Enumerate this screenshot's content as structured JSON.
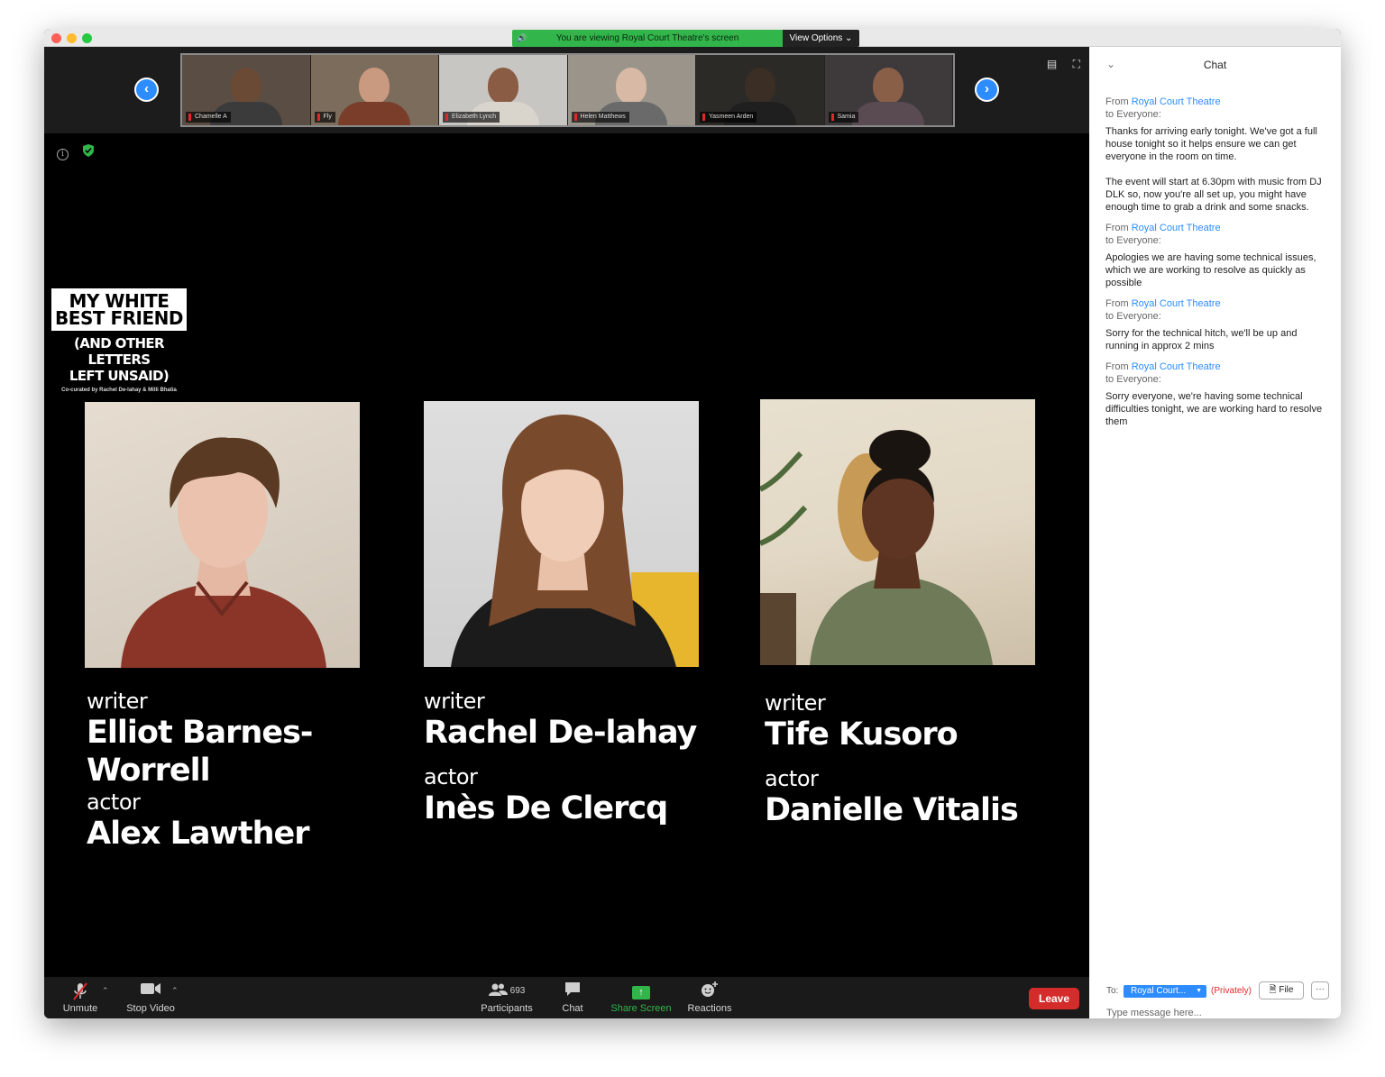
{
  "window": {
    "share_banner": "You are viewing Royal Court Theatre's screen",
    "view_options": "View Options ⌄"
  },
  "thumbnails": [
    {
      "name": "Chamelle A",
      "skin": "#6b4a35",
      "shirt": "#3b3b3b",
      "bg": "#5a4e44"
    },
    {
      "name": "Fly",
      "skin": "#c99a80",
      "shirt": "#7a3d2a",
      "bg": "#7b6c5c"
    },
    {
      "name": "Elizabeth Lynch",
      "skin": "#8a5c44",
      "shirt": "#d9d4cc",
      "bg": "#c8c6c2"
    },
    {
      "name": "Helen Matthews",
      "skin": "#d8b9a5",
      "shirt": "#6a6a6a",
      "bg": "#9a948a"
    },
    {
      "name": "Yasmeen Arden",
      "skin": "#3a2e25",
      "shirt": "#1f1f1f",
      "bg": "#2c2a26"
    },
    {
      "name": "Samia",
      "skin": "#8a5f48",
      "shirt": "#5a4a52",
      "bg": "#3e3a3c"
    }
  ],
  "poster": {
    "title_line1": "MY WHITE",
    "title_line2": "BEST FRIEND",
    "subtitle_line1": "(AND OTHER LETTERS",
    "subtitle_line2": "LEFT UNSAID)",
    "credit": "Co-curated by Rachel De-lahay & Milli Bhatia"
  },
  "credits": [
    {
      "role1": "writer",
      "name1": "Elliot Barnes-Worrell",
      "role2": "actor",
      "name2": "Alex Lawther"
    },
    {
      "role1": "writer",
      "name1": "Rachel De-lahay",
      "role2": "actor",
      "name2": "Inès De Clercq"
    },
    {
      "role1": "writer",
      "name1": "Tife Kusoro",
      "role2": "actor",
      "name2": "Danielle Vitalis"
    }
  ],
  "toolbar": {
    "unmute": "Unmute",
    "stop_video": "Stop Video",
    "participants": "Participants",
    "participant_count": "693",
    "chat": "Chat",
    "share_screen": "Share Screen",
    "reactions": "Reactions",
    "leave": "Leave"
  },
  "chat": {
    "title": "Chat",
    "messages": [
      {
        "from_prefix": "From",
        "sender": "Royal Court Theatre",
        "to": "to Everyone:",
        "paragraphs": [
          "Thanks for arriving early tonight. We've got a full house tonight so it helps ensure we can get everyone in the room on time.",
          "The event will start at 6.30pm with music from DJ DLK so, now you're all set up, you might have enough time to grab a drink and some snacks."
        ]
      },
      {
        "from_prefix": "From",
        "sender": "Royal Court Theatre",
        "to": "to Everyone:",
        "paragraphs": [
          "Apologies we are having some technical issues, which we are working to resolve as quickly as possible"
        ]
      },
      {
        "from_prefix": "From",
        "sender": "Royal Court Theatre",
        "to": "to Everyone:",
        "paragraphs": [
          "Sorry for the technical hitch, we'll be up and running in approx 2 mins"
        ]
      },
      {
        "from_prefix": "From",
        "sender": "Royal Court Theatre",
        "to": "to Everyone:",
        "paragraphs": [
          "Sorry everyone, we're having some technical difficulties tonight, we are working hard to resolve them"
        ]
      }
    ],
    "to_label": "To:",
    "recipient": "Royal Court...",
    "privately": "(Privately)",
    "file_button": "File",
    "more_button": "···",
    "input_placeholder": "Type message here..."
  },
  "colors": {
    "accent_blue": "#2d8cff",
    "share_green": "#32b54a",
    "leave_red": "#d42c2a"
  }
}
